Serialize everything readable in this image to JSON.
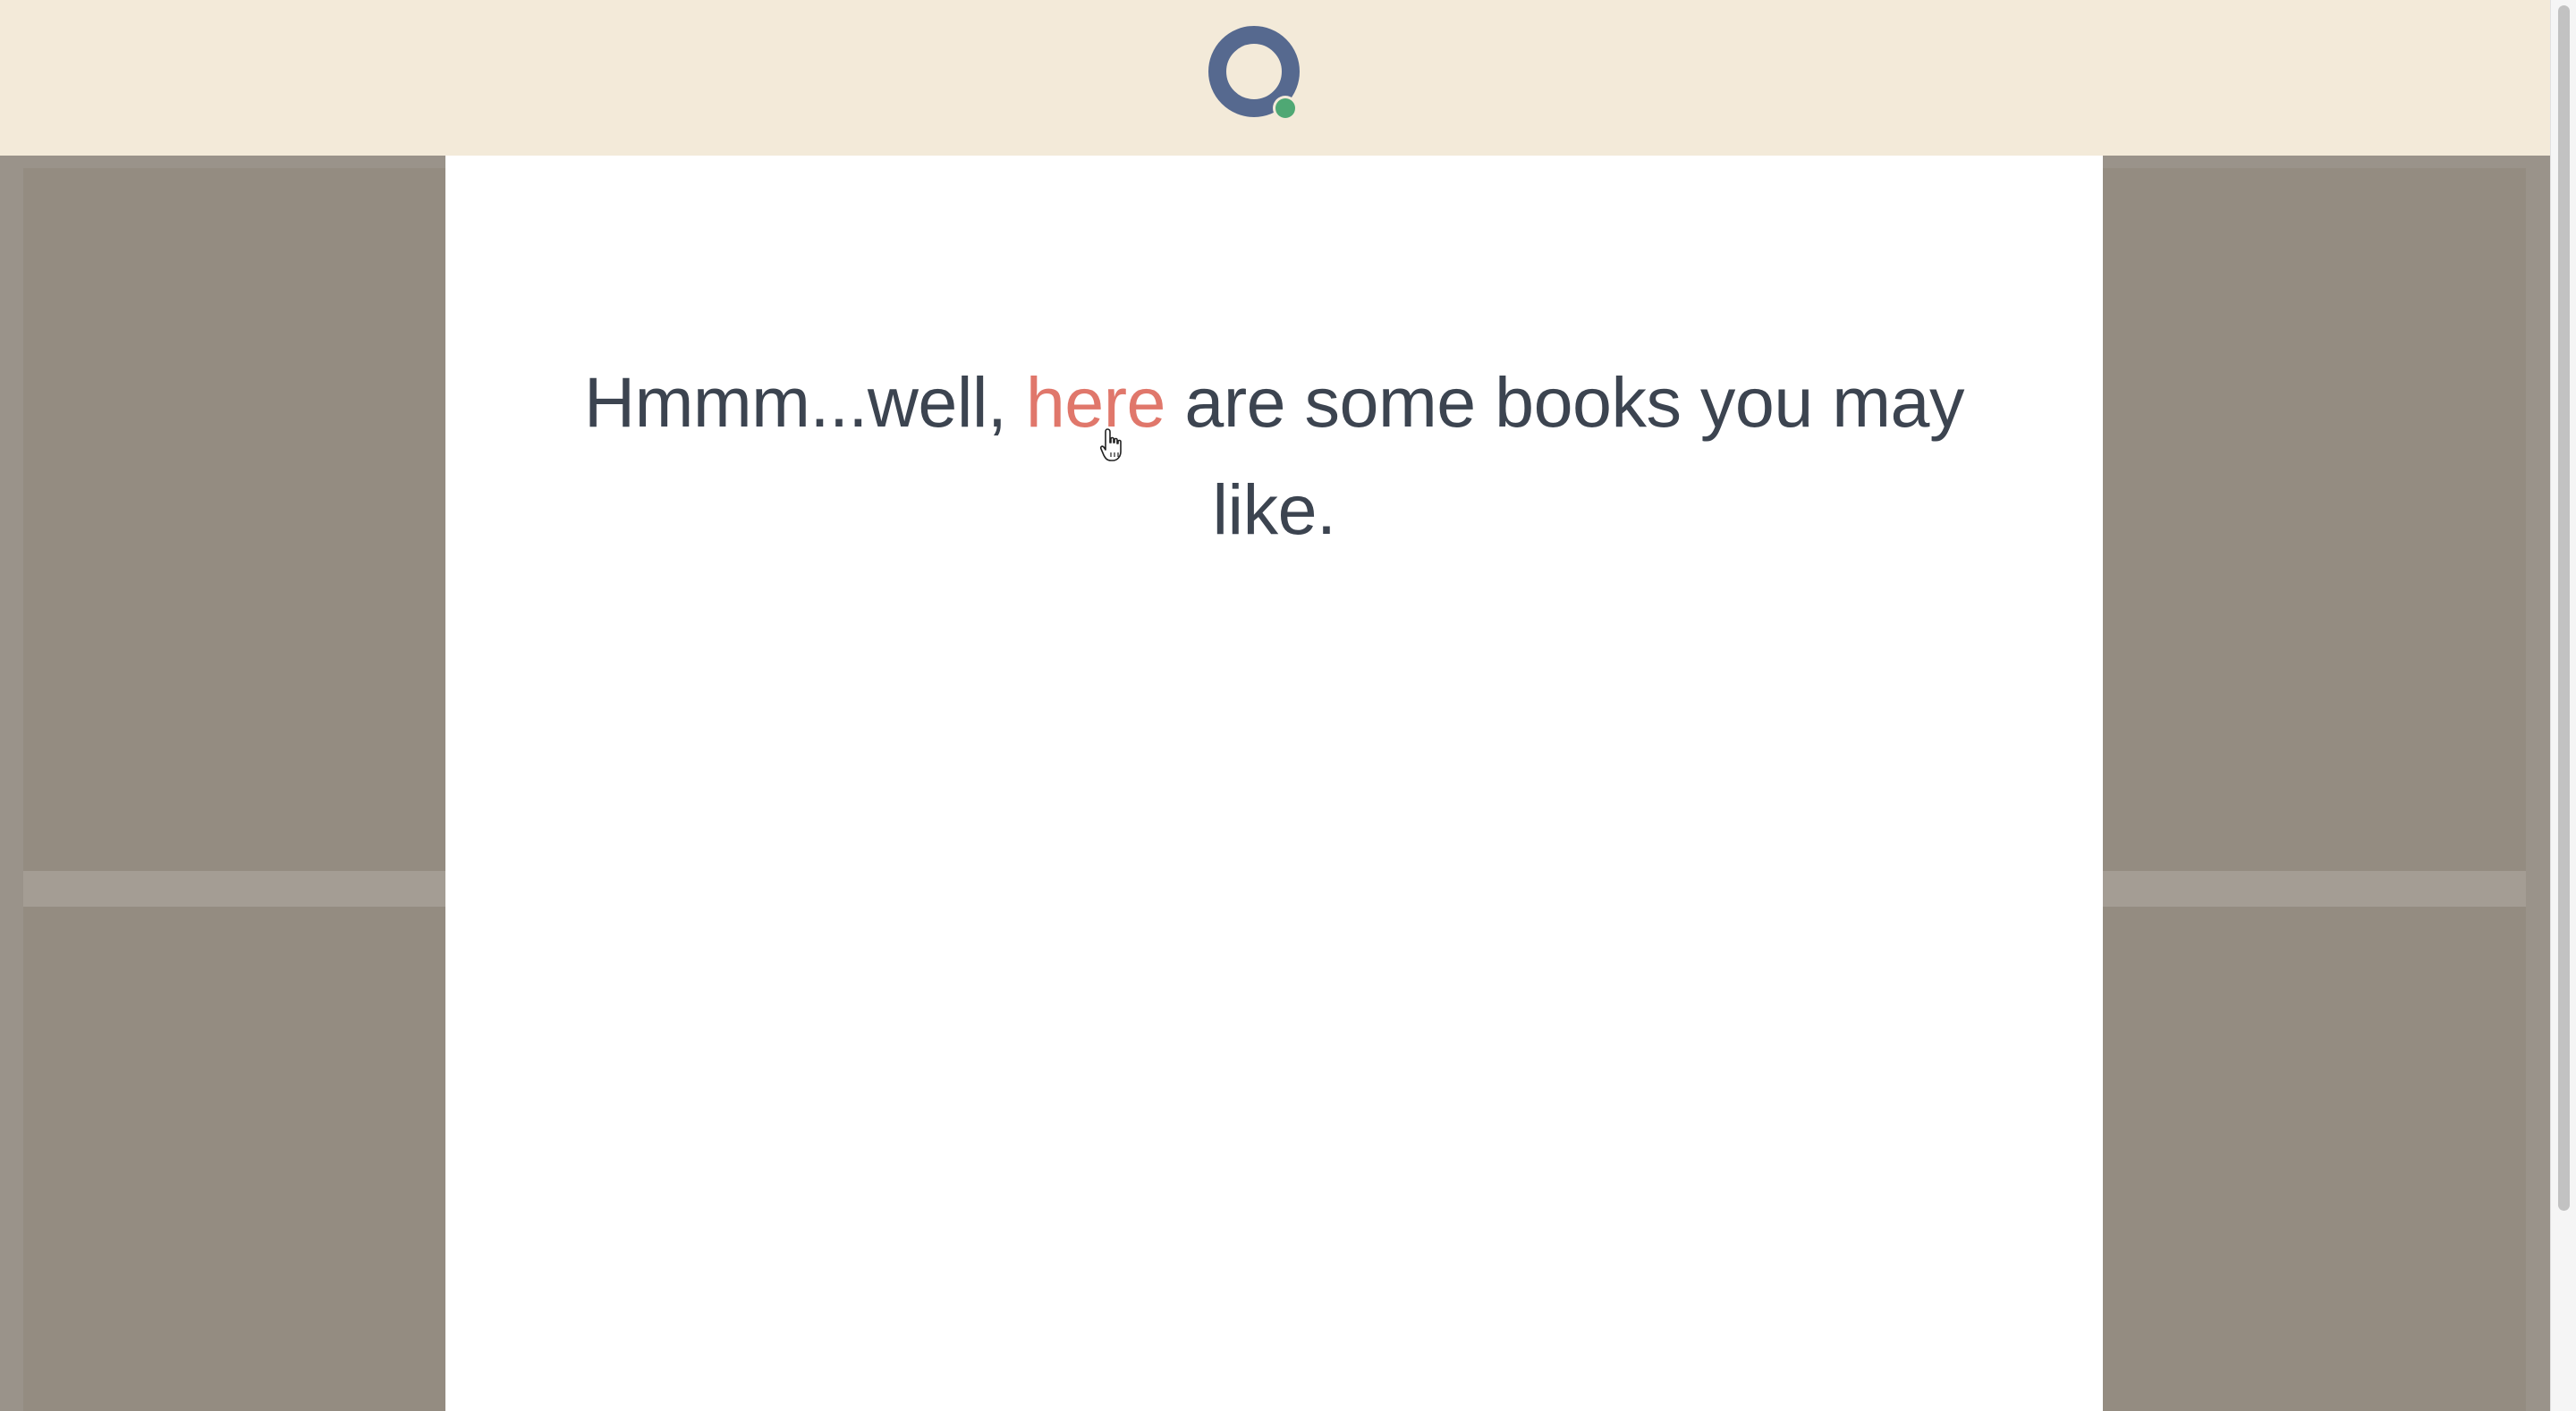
{
  "header": {
    "logo_icon": "circle-logo-icon",
    "brand_color": "#56698f",
    "status_dot_color": "#4fa874",
    "background_color": "#f3ead9"
  },
  "modal": {
    "message_before": "Hmmm...well, ",
    "link_text": "here",
    "message_after": " are some books you may like.",
    "link_color": "#e0776b",
    "text_color": "#3c4450"
  },
  "cursor": {
    "icon": "hand-pointer-icon"
  }
}
